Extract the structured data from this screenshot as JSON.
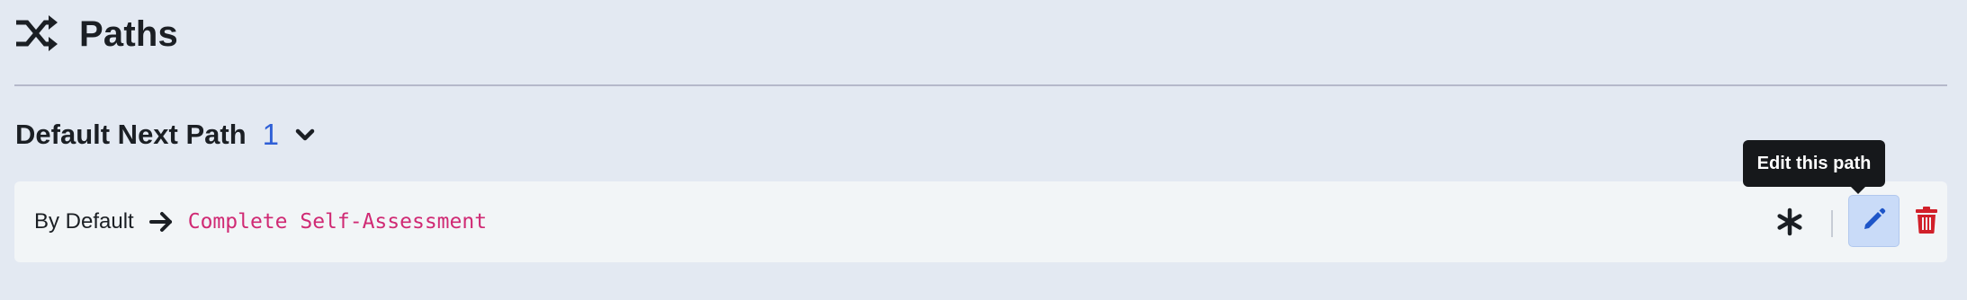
{
  "header": {
    "title": "Paths",
    "icon": "shuffle-icon"
  },
  "default_section": {
    "label": "Default Next Path",
    "count": "1",
    "toggle_icon": "chevron-down-icon"
  },
  "path": {
    "condition": "By Default",
    "arrow_icon": "arrow-right-icon",
    "target": "Complete Self-Assessment",
    "target_color": "#d02a74"
  },
  "actions": {
    "asterisk_icon": "asterisk-icon",
    "edit_icon": "pencil-icon",
    "delete_icon": "trash-icon",
    "edit_tooltip": "Edit this path"
  },
  "colors": {
    "background": "#e3e9f2",
    "card": "#f2f5f7",
    "accent_count": "#2f5fd6",
    "edit_bg": "#c9dbf8",
    "edit_icon": "#1e55c8",
    "delete_icon": "#d1202a",
    "tooltip_bg": "#16181b"
  }
}
